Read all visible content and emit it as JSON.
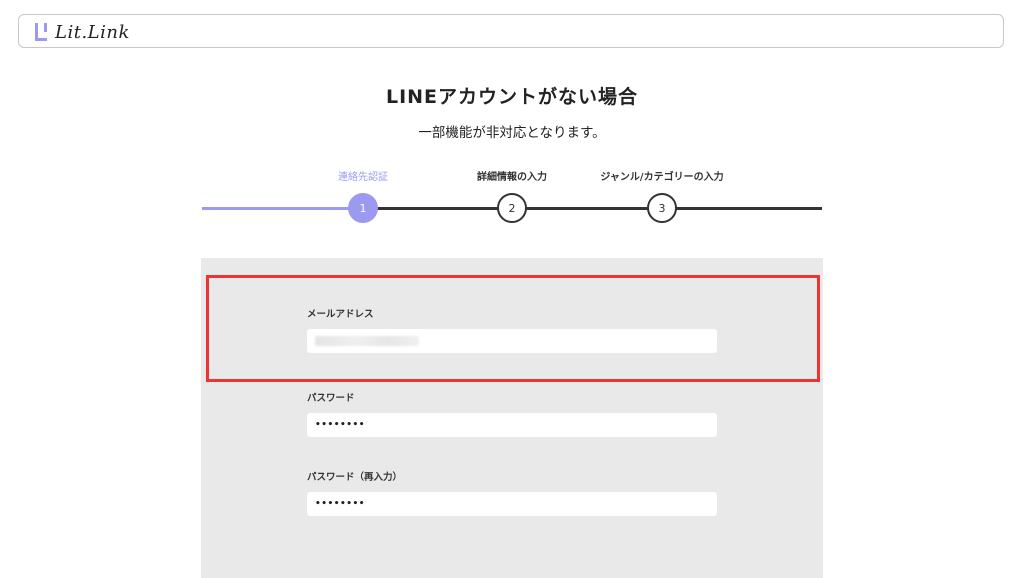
{
  "header": {
    "logo_text": "Lit.Link"
  },
  "main": {
    "title": "LINEアカウントがない場合",
    "subtitle": "一部機能が非対応となります。"
  },
  "steps": [
    {
      "label": "連絡先認証",
      "number": "1",
      "active": true
    },
    {
      "label": "詳細情報の入力",
      "number": "2",
      "active": false
    },
    {
      "label": "ジャンル/カテゴリーの入力",
      "number": "3",
      "active": false
    }
  ],
  "form": {
    "email_label": "メールアドレス",
    "email_value": "",
    "password_label": "パスワード",
    "password_mask": "••••••••",
    "password_confirm_label": "パスワード（再入力）",
    "password_confirm_mask": "••••••••"
  },
  "colors": {
    "accent": "#9c9af0",
    "highlight": "#ee3333",
    "card_bg": "#e9e9e9"
  }
}
